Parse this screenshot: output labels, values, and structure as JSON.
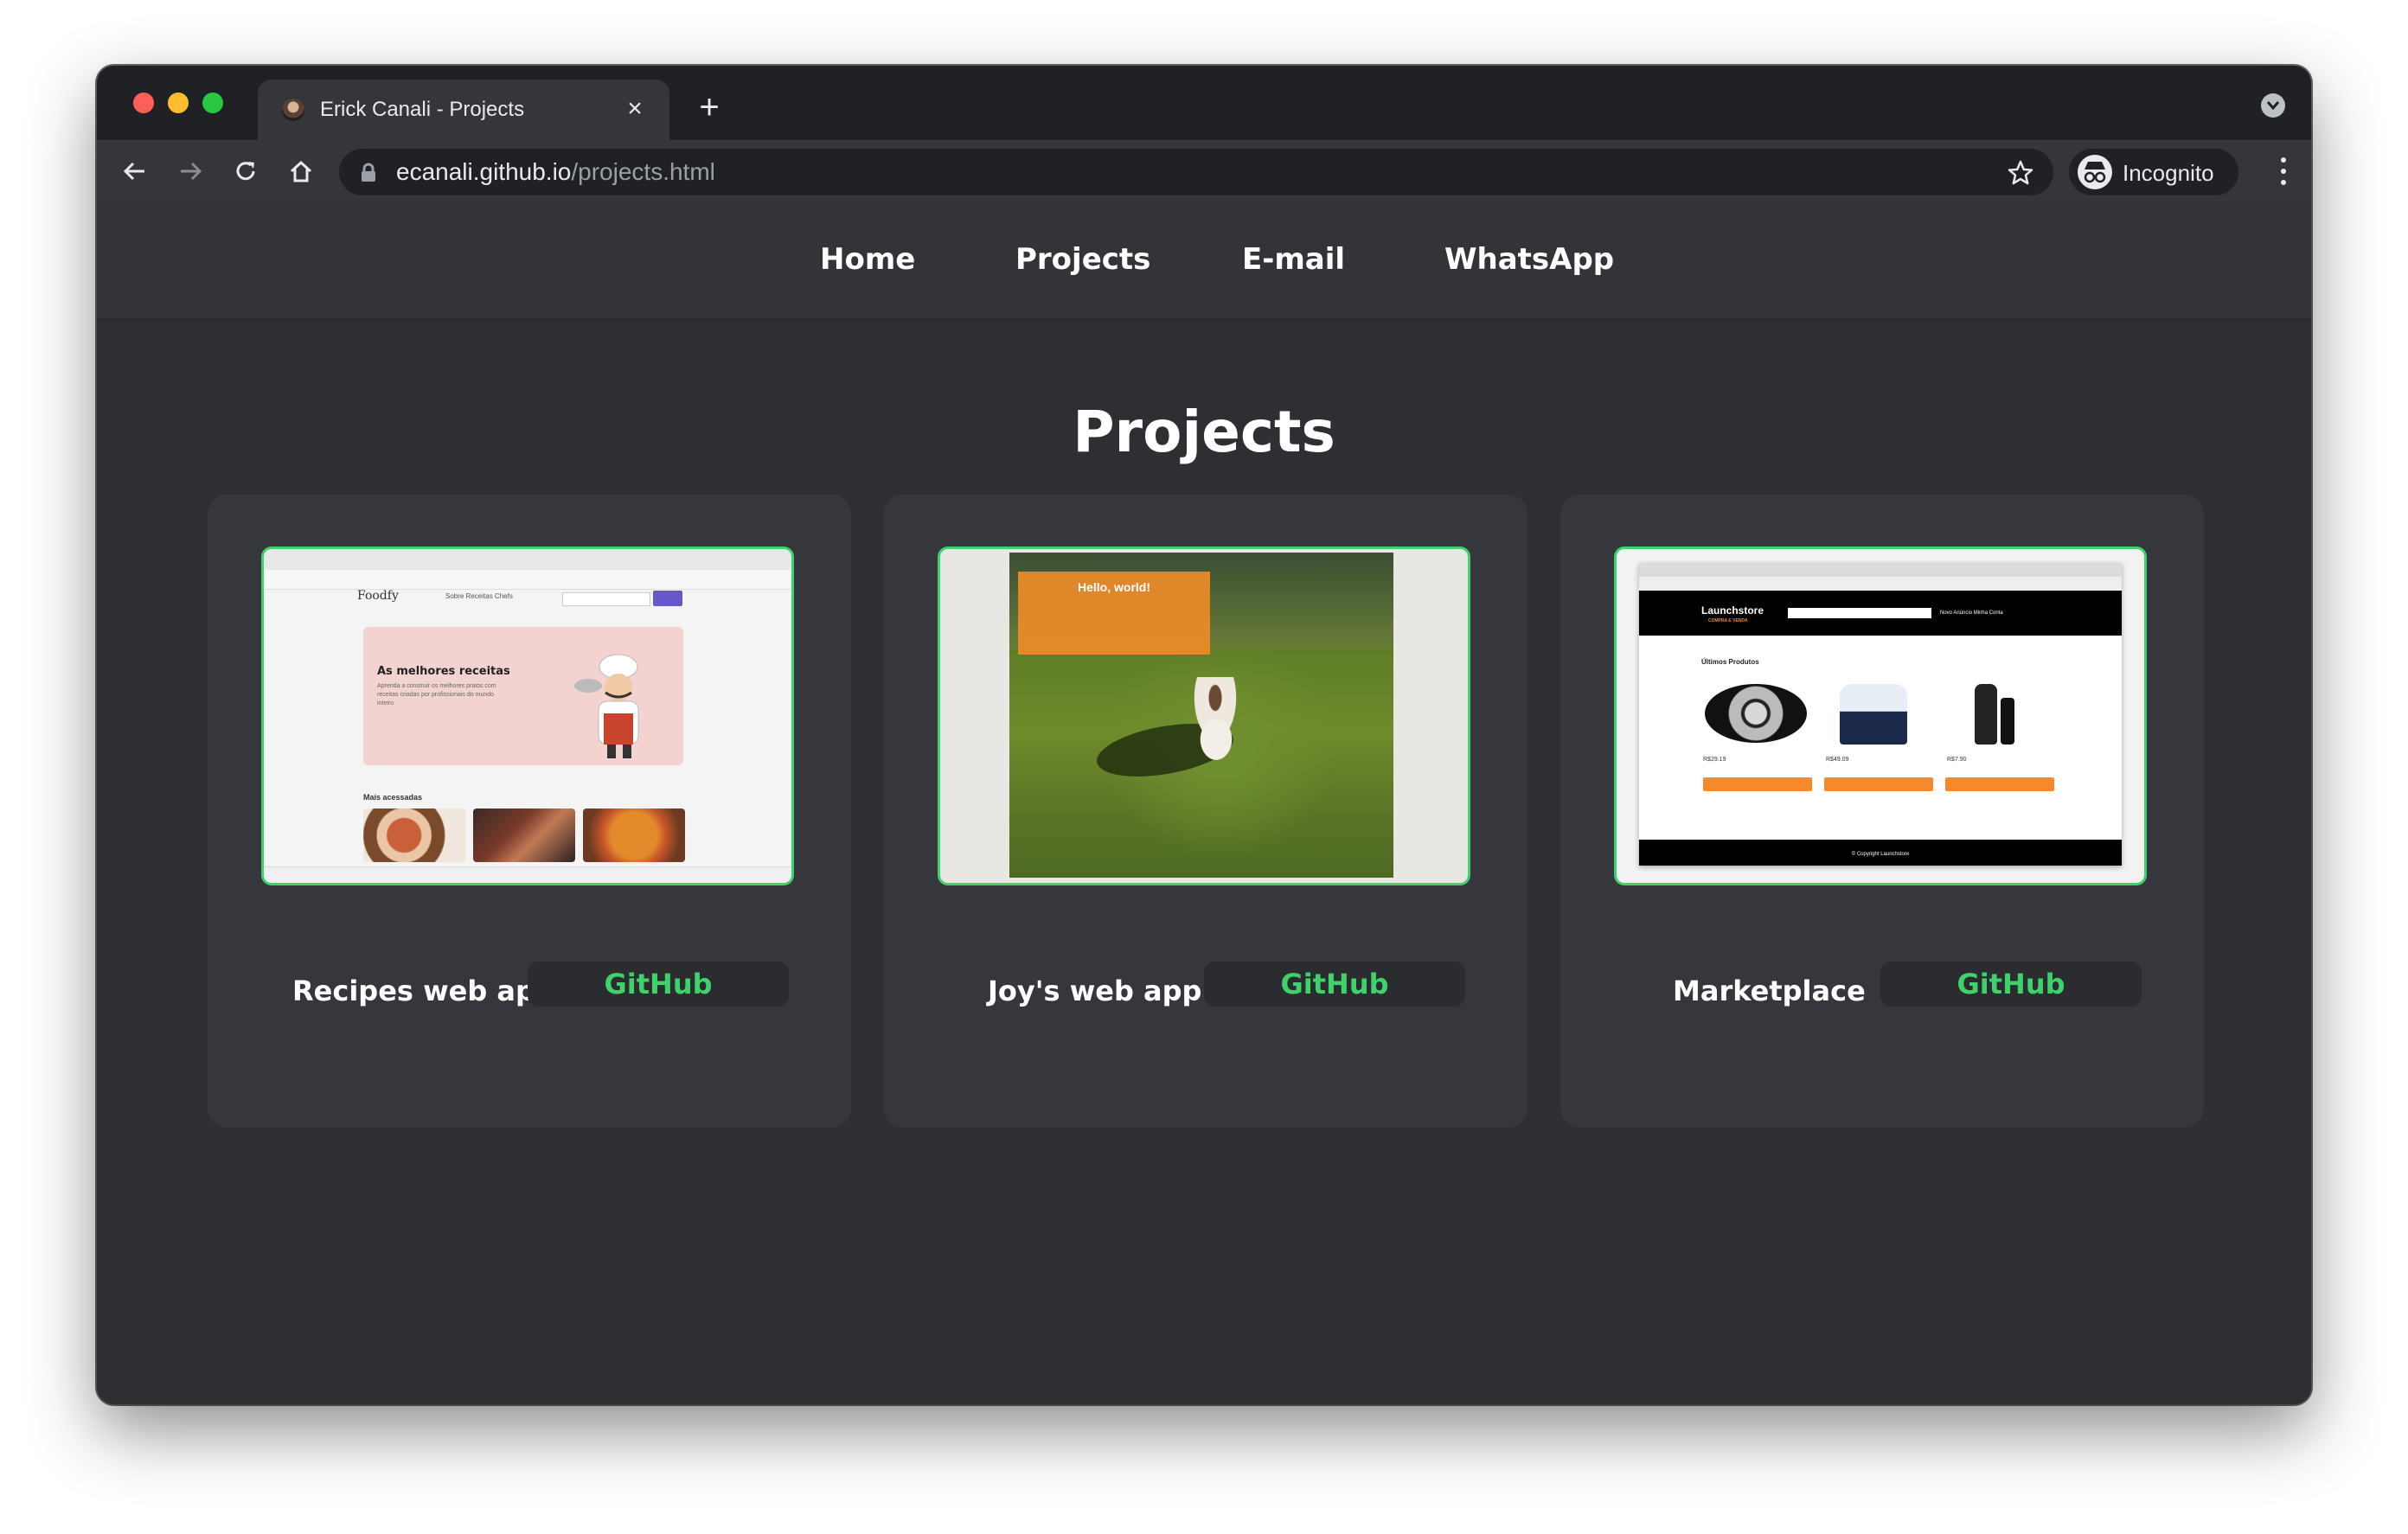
{
  "browser": {
    "tab_title": "Erick Canali - Projects",
    "close_symbol": "×",
    "new_tab_symbol": "+",
    "url_host": "ecanali.github.io",
    "url_path": "/projects.html",
    "profile_label": "Incognito",
    "icons": [
      "back-arrow-icon",
      "forward-arrow-icon",
      "reload-icon",
      "home-icon",
      "lock-icon",
      "star-icon",
      "incognito-icon",
      "more-vert-icon",
      "tab-search-icon"
    ]
  },
  "nav": {
    "items": [
      {
        "label": "Home"
      },
      {
        "label": "Projects"
      },
      {
        "label": "E-mail"
      },
      {
        "label": "WhatsApp"
      }
    ]
  },
  "page": {
    "title": "Projects"
  },
  "projects": [
    {
      "name": "Recipes web app",
      "button": "GitHub",
      "preview": {
        "logo": "Foodfy",
        "links": "Sobre   Receitas   Chefs",
        "hero_title": "As melhores receitas",
        "hero_text": "Aprenda a construir os melhores pratos com receitas criadas por profissionais do mundo inteiro.",
        "section": "Mais acessadas"
      }
    },
    {
      "name": "Joy's web app",
      "button": "GitHub",
      "preview": {
        "hello": "Hello, world!"
      }
    },
    {
      "name": "Marketplace",
      "button": "GitHub",
      "preview": {
        "brand": "Launchstore",
        "brand_sub": "COMPRA E VENDA",
        "header_links": "Novo Anúncio   Minha Conta",
        "section": "Últimos Produtos",
        "prices": [
          "R$29.19",
          "R$49.09",
          "R$7.90"
        ],
        "footer": "© Copyright Launchstore"
      }
    }
  ],
  "colors": {
    "accent_green": "#3ed26b",
    "page_bg": "#2d2f33",
    "card_bg": "#35373c"
  }
}
